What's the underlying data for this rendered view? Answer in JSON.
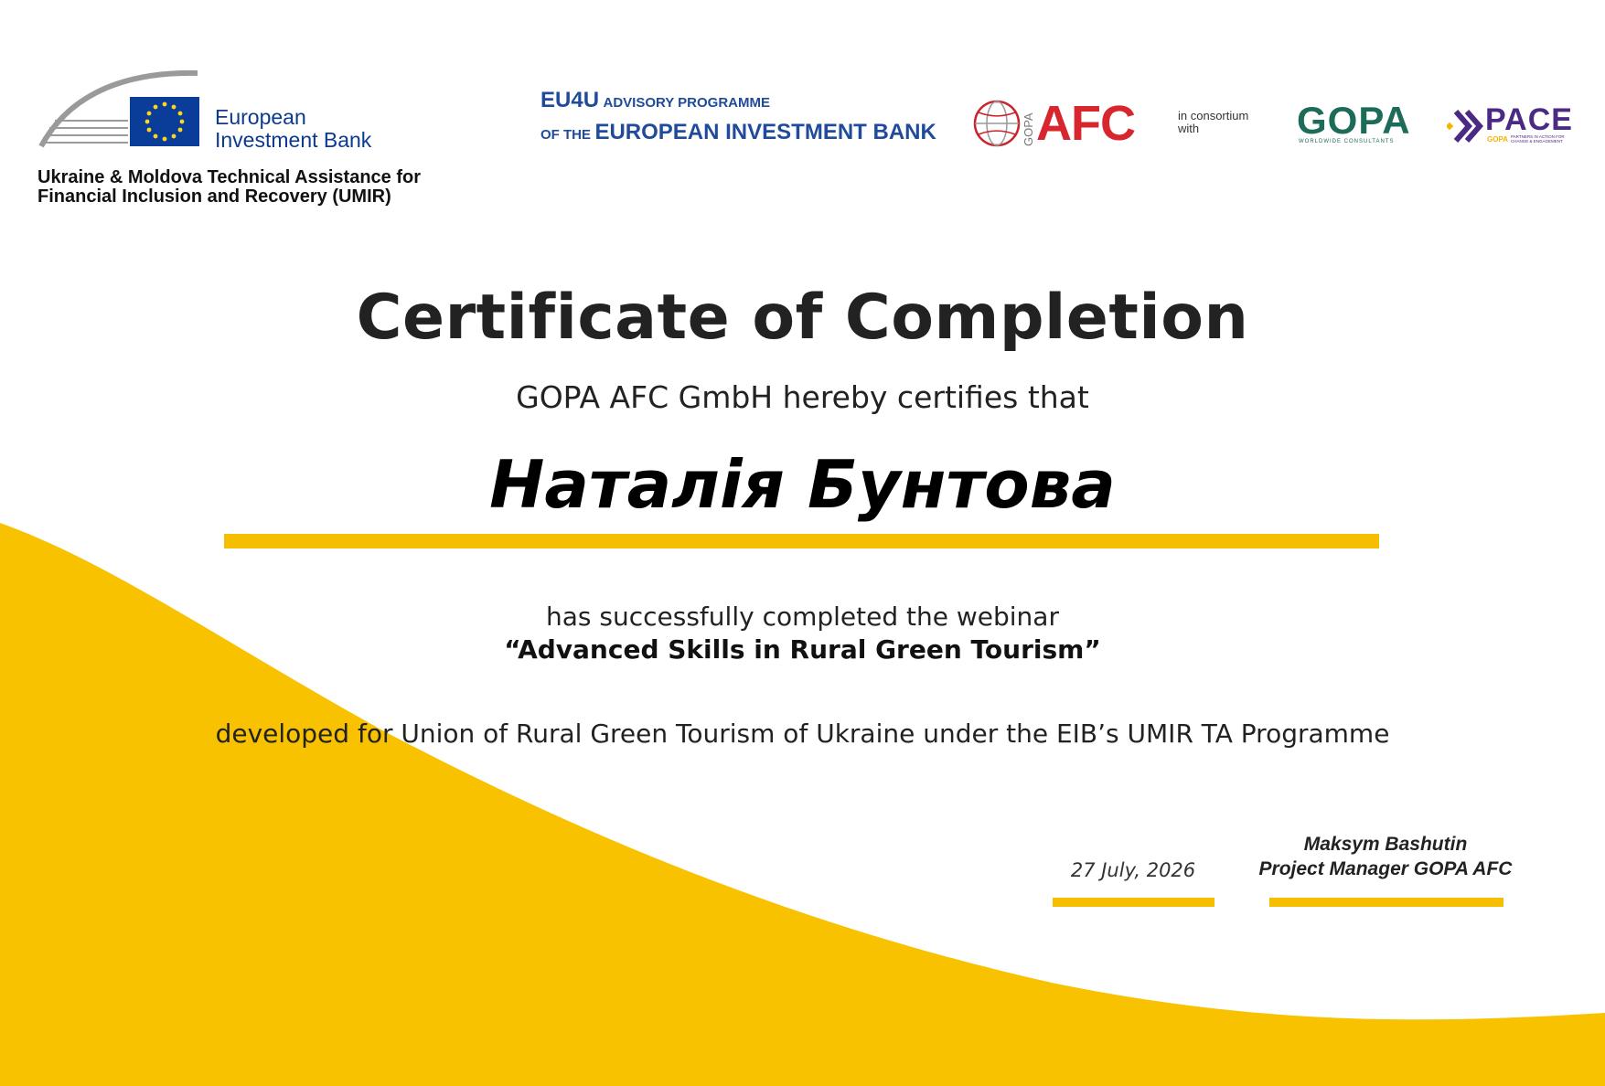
{
  "colors": {
    "accent_yellow": "#F6BE00",
    "eib_blue": "#0B3A8F",
    "afc_red": "#D7262E",
    "gopa_green": "#1D6B59",
    "pace_purple": "#4B2A84"
  },
  "header": {
    "eib_logo": {
      "line1": "European",
      "line2": "Investment Bank"
    },
    "umir": {
      "line1": "Ukraine & Moldova Technical Assistance for",
      "line2": "Financial Inclusion and Recovery (UMIR)"
    },
    "eu4u": {
      "prefix_big": "EU4U",
      "prefix_small": "ADVISORY PROGRAMME",
      "of_the": "OF THE",
      "bank": "EUROPEAN INVESTMENT BANK"
    },
    "afc_logo": {
      "gopa": "GOPA",
      "afc": "AFC"
    },
    "consortium": {
      "line1": "in consortium",
      "line2": "with"
    },
    "gopa_logo": {
      "name": "GOPA",
      "tagline": "WORLDWIDE CONSULTANTS"
    },
    "pace_logo": {
      "name": "PACE",
      "gopa": "GOPA",
      "tagline": "PARTNERS IN ACTION FOR CHANGE & ENGAGEMENT"
    }
  },
  "certificate": {
    "title": "Certificate of Completion",
    "certifies": "GOPA AFC GmbH hereby certifies that",
    "recipient": "Наталія Бунтова",
    "completed": "has successfully completed the webinar",
    "webinar": "“Advanced Skills in Rural Green Tourism”",
    "developed": "developed for Union of Rural Green Tourism of Ukraine under the EIB’s UMIR TA Programme"
  },
  "signature": {
    "date": "27 July, 2026",
    "signer_name": "Maksym Bashutin",
    "signer_title": "Project Manager GOPA AFC"
  }
}
